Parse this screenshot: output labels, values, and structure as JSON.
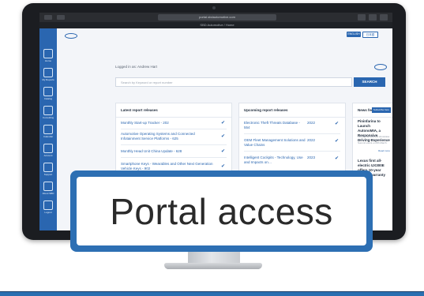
{
  "browser": {
    "url": "portal.sbdautomotive.com",
    "tab_title": "SBD Automotive / Home"
  },
  "sidebar": {
    "items": [
      {
        "label": "Home"
      },
      {
        "label": "My Reports"
      },
      {
        "label": "Catalog"
      },
      {
        "label": "Consulting"
      },
      {
        "label": "Calendar"
      },
      {
        "label": "Account"
      },
      {
        "label": "Support"
      },
      {
        "label": "About SBD"
      },
      {
        "label": "Logout"
      }
    ]
  },
  "header": {
    "lang_primary": "ENGLISH",
    "lang_secondary": "日本語",
    "logged_in": "Logged in as: Andrew Hart",
    "search_placeholder": "Search by Keyword or report number",
    "search_button": "SEARCH"
  },
  "latest": {
    "title": "Latest report releases",
    "items": [
      "Monthly Start-up Tracker - 202",
      "Automotive Operating Systems and Connected Infotainment Service Platforms - 625",
      "Monthly Head Unit China Update - 628",
      "Smartphone Keys - Wearables and Other Next Generation Vehicle Keys - 902"
    ]
  },
  "upcoming": {
    "title": "Upcoming report releases",
    "items": [
      {
        "name": "Electronic Theft Threats Database - 554",
        "year": "2022"
      },
      {
        "name": "OEM Fleet Management Solutions and Value Chains",
        "year": "2022"
      },
      {
        "name": "Intelligent Cockpits - Technology, Use and Impacts on…",
        "year": "2023"
      }
    ]
  },
  "news": {
    "title": "News feed",
    "button": "Subscribe here",
    "items": [
      {
        "headline": "Pininfarina to Launch AutonoMIA, a Responsive Driving Experience",
        "body": "Pininfarina SBD will showcase AutonoMIA at the Automotive Summit event on 8th March.",
        "more": "Read more"
      },
      {
        "headline": "Lexus first all-electric UX300E offers 10-year battery warranty",
        "body": "",
        "more": ""
      }
    ]
  },
  "overlay": {
    "text": "Portal access"
  },
  "colors": {
    "brand_blue": "#2a66b0",
    "frame_blue": "#2d6fb3",
    "monitor_dark": "#1b1d21"
  }
}
